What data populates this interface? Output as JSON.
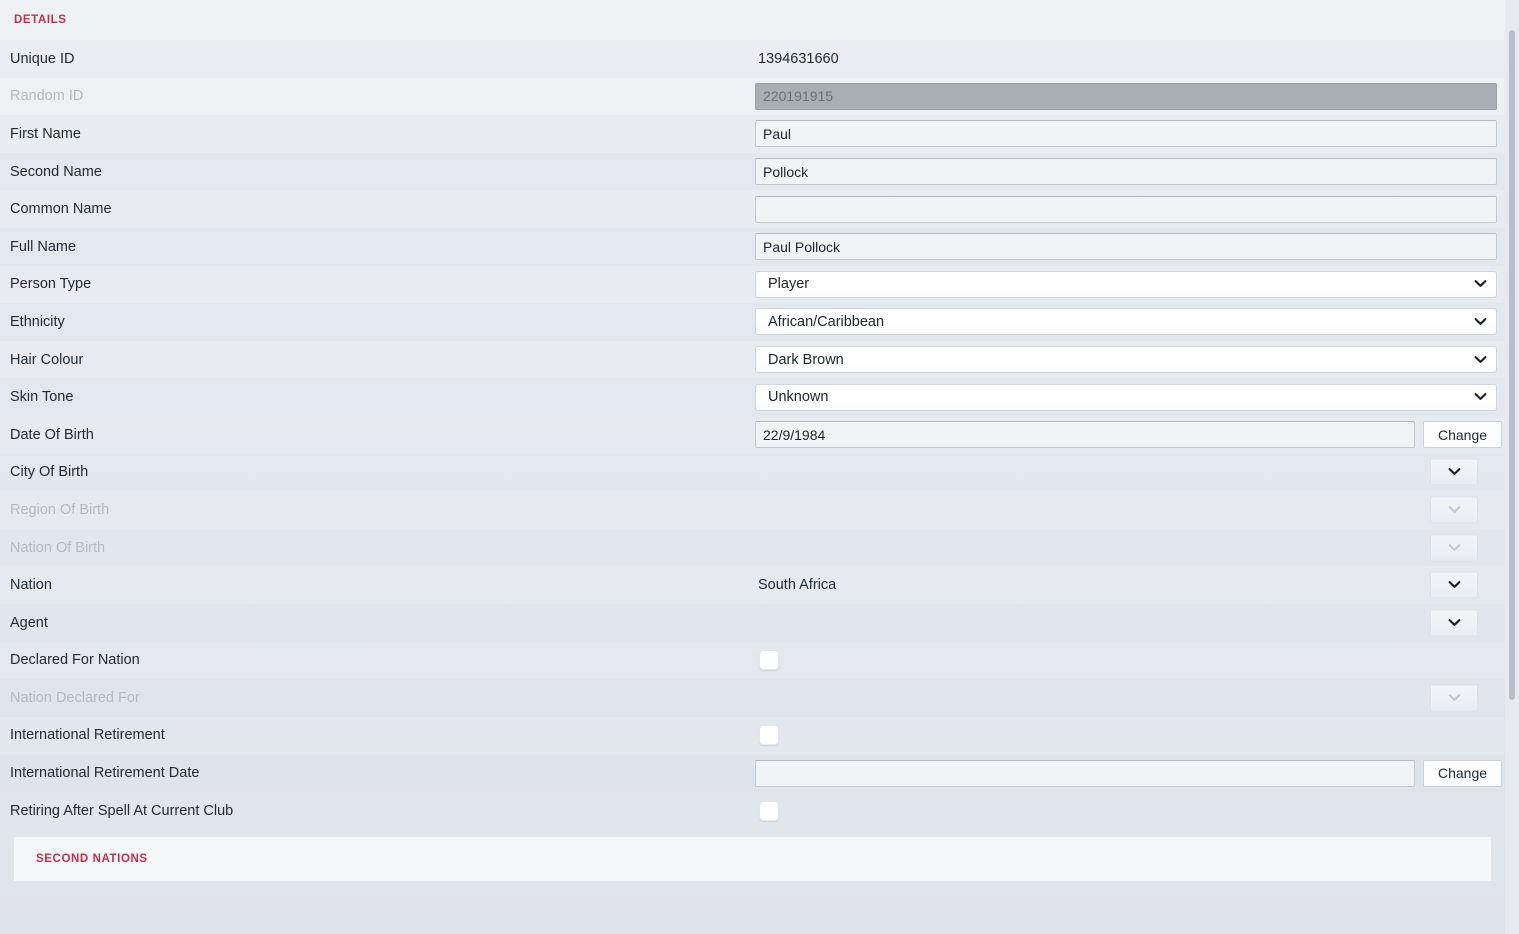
{
  "sections": {
    "details": {
      "title": "DETAILS"
    },
    "second_nations": {
      "title": "SECOND NATIONS"
    }
  },
  "icons": {
    "chevron_down": "chevron-down-icon"
  },
  "colors": {
    "accent": "#c0304a",
    "page_bg": "#e6eaef",
    "input_bg": "#f2f3f5",
    "readonly_bg": "#a9aeb4",
    "text": "#212b36",
    "disabled_text": "#b2bac3"
  },
  "buttons": {
    "change_label": "Change"
  },
  "fields": {
    "unique_id": {
      "label": "Unique ID",
      "value": "1394631660"
    },
    "random_id": {
      "label": "Random ID",
      "value": "220191915"
    },
    "first_name": {
      "label": "First Name",
      "value": "Paul"
    },
    "second_name": {
      "label": "Second Name",
      "value": "Pollock"
    },
    "common_name": {
      "label": "Common Name",
      "value": ""
    },
    "full_name": {
      "label": "Full Name",
      "value": "Paul Pollock"
    },
    "person_type": {
      "label": "Person Type",
      "value": "Player"
    },
    "ethnicity": {
      "label": "Ethnicity",
      "value": "African/Caribbean"
    },
    "hair_colour": {
      "label": "Hair Colour",
      "value": "Dark Brown"
    },
    "skin_tone": {
      "label": "Skin Tone",
      "value": "Unknown"
    },
    "date_of_birth": {
      "label": "Date Of Birth",
      "value": "22/9/1984"
    },
    "city_of_birth": {
      "label": "City Of Birth",
      "value": ""
    },
    "region_of_birth": {
      "label": "Region Of Birth",
      "value": ""
    },
    "nation_of_birth": {
      "label": "Nation Of Birth",
      "value": ""
    },
    "nation": {
      "label": "Nation",
      "value": "South Africa"
    },
    "agent": {
      "label": "Agent",
      "value": ""
    },
    "declared_for_nation": {
      "label": "Declared For Nation",
      "value": ""
    },
    "nation_declared_for": {
      "label": "Nation Declared For",
      "value": ""
    },
    "international_retirement": {
      "label": "International Retirement",
      "value": ""
    },
    "international_retirement_date": {
      "label": "International Retirement Date",
      "value": ""
    },
    "retiring_after_spell": {
      "label": "Retiring After Spell At Current Club",
      "value": ""
    }
  }
}
